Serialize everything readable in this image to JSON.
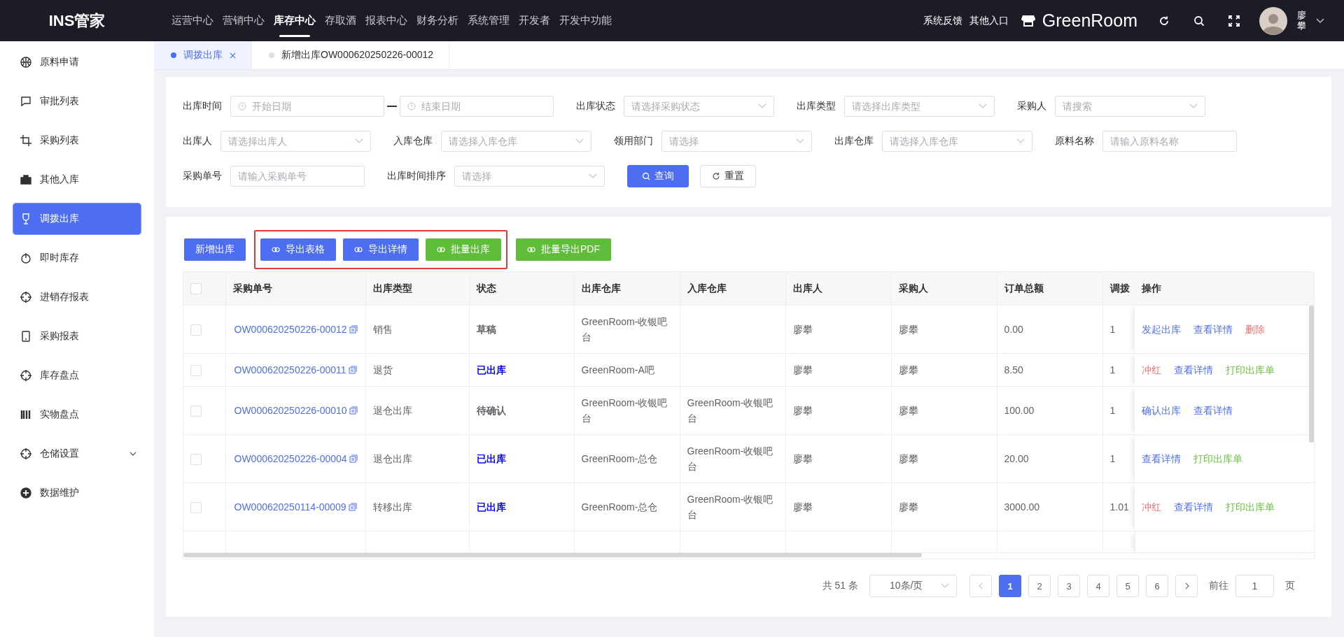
{
  "header": {
    "logo": "INS管家",
    "nav": [
      {
        "label": "运营中心",
        "selected": false
      },
      {
        "label": "营销中心",
        "selected": false
      },
      {
        "label": "库存中心",
        "selected": true
      },
      {
        "label": "存取酒",
        "selected": false
      },
      {
        "label": "报表中心",
        "selected": false
      },
      {
        "label": "财务分析",
        "selected": false
      },
      {
        "label": "系统管理",
        "selected": false
      },
      {
        "label": "开发者",
        "selected": false
      },
      {
        "label": "开发中功能",
        "selected": false
      }
    ],
    "links": [
      "系统反馈",
      "其他入口"
    ],
    "store": "GreenRoom",
    "user": "廖攀"
  },
  "sidebar": {
    "items": [
      {
        "label": "原料申请",
        "selected": false
      },
      {
        "label": "审批列表",
        "selected": false
      },
      {
        "label": "采购列表",
        "selected": false
      },
      {
        "label": "其他入库",
        "selected": false
      },
      {
        "label": "调拨出库",
        "selected": true
      },
      {
        "label": "即时库存",
        "selected": false
      },
      {
        "label": "进销存报表",
        "selected": false
      },
      {
        "label": "采购报表",
        "selected": false
      },
      {
        "label": "库存盘点",
        "selected": false
      },
      {
        "label": "实物盘点",
        "selected": false
      },
      {
        "label": "仓储设置",
        "selected": false,
        "expanded": false
      },
      {
        "label": "数据维护",
        "selected": false
      }
    ]
  },
  "tabs": [
    {
      "label": "调拨出库",
      "selected": true,
      "closable": true
    },
    {
      "label": "新增出库OW000620250226-00012",
      "selected": false,
      "closable": false
    }
  ],
  "filters": [
    [
      {
        "label": "出库时间",
        "kind": "date-range",
        "placeholder": "开始日期",
        "placeholder_end": "结束日期"
      },
      {
        "label": "出库状态",
        "kind": "select",
        "placeholder": "请选择采购状态"
      },
      {
        "label": "出库类型",
        "kind": "select",
        "placeholder": "请选择出库类型"
      },
      {
        "label": "采购人",
        "kind": "select",
        "placeholder": "请搜索"
      }
    ],
    [
      {
        "label": "出库人",
        "kind": "select",
        "placeholder": "请选择出库人"
      },
      {
        "label": "入库仓库",
        "kind": "select",
        "placeholder": "请选择入库仓库"
      },
      {
        "label": "领用部门",
        "kind": "select",
        "placeholder": "请选择"
      },
      {
        "label": "出库仓库",
        "kind": "select",
        "placeholder": "请选择入库仓库"
      },
      {
        "label": "原料名称",
        "kind": "input",
        "placeholder": "请输入原料名称"
      }
    ],
    [
      {
        "label": "采购单号",
        "kind": "input",
        "placeholder": "请输入采购单号"
      },
      {
        "label": "出库时间排序",
        "kind": "select",
        "placeholder": "请选择"
      }
    ]
  ],
  "filter_buttons": [
    {
      "label": "查询",
      "kind": "primary"
    },
    {
      "label": "重置",
      "kind": "default"
    }
  ],
  "action_groups": [
    {
      "framed": false,
      "buttons": [
        {
          "label": "新增出库",
          "kind": "primary",
          "icon": false
        }
      ]
    },
    {
      "framed": true,
      "buttons": [
        {
          "label": "导出表格",
          "kind": "primary",
          "icon": true
        },
        {
          "label": "导出详情",
          "kind": "primary",
          "icon": true
        },
        {
          "label": "批量出库",
          "kind": "success",
          "icon": true
        }
      ]
    },
    {
      "framed": false,
      "buttons": [
        {
          "label": "批量导出PDF",
          "kind": "success",
          "icon": true
        }
      ]
    }
  ],
  "table": {
    "select_all_checked": false,
    "columns": [
      "采购单号",
      "出库类型",
      "状态",
      "出库仓库",
      "入库仓库",
      "出库人",
      "采购人",
      "订单总额",
      "调拨",
      "操作"
    ],
    "rows": [
      {
        "checked": false,
        "order": "OW000620250226-00012",
        "type": "销售",
        "status": {
          "text": "草稿",
          "color": "#606266"
        },
        "out_wh": "GreenRoom-收银吧台",
        "in_wh": "",
        "out_person": "廖攀",
        "buyer": "廖攀",
        "total": "0.00",
        "transfer": "1",
        "ops": [
          {
            "label": "发起出库",
            "kind": "primary"
          },
          {
            "label": "查看详情",
            "kind": "primary"
          },
          {
            "label": "删除",
            "kind": "danger"
          }
        ]
      },
      {
        "checked": false,
        "order": "OW000620250226-00011",
        "type": "退货",
        "status": {
          "text": "已出库",
          "color": "#0000ff"
        },
        "out_wh": "GreenRoom-A吧",
        "in_wh": "",
        "out_person": "廖攀",
        "buyer": "廖攀",
        "total": "8.50",
        "transfer": "1",
        "ops": [
          {
            "label": "冲红",
            "kind": "danger"
          },
          {
            "label": "查看详情",
            "kind": "primary"
          },
          {
            "label": "打印出库单",
            "kind": "success"
          }
        ]
      },
      {
        "checked": false,
        "order": "OW000620250226-00010",
        "type": "退仓出库",
        "status": {
          "text": "待确认",
          "color": "#606266"
        },
        "out_wh": "GreenRoom-收银吧台",
        "in_wh": "GreenRoom-收银吧台",
        "out_person": "廖攀",
        "buyer": "廖攀",
        "total": "100.00",
        "transfer": "1",
        "ops": [
          {
            "label": "确认出库",
            "kind": "primary"
          },
          {
            "label": "查看详情",
            "kind": "primary"
          }
        ]
      },
      {
        "checked": false,
        "order": "OW000620250226-00004",
        "type": "退仓出库",
        "status": {
          "text": "已出库",
          "color": "#0000ff"
        },
        "out_wh": "GreenRoom-总仓",
        "in_wh": "GreenRoom-收银吧台",
        "out_person": "廖攀",
        "buyer": "廖攀",
        "total": "20.00",
        "transfer": "1",
        "ops": [
          {
            "label": "查看详情",
            "kind": "primary"
          },
          {
            "label": "打印出库单",
            "kind": "success"
          }
        ]
      },
      {
        "checked": false,
        "order": "OW000620250114-00009",
        "type": "转移出库",
        "status": {
          "text": "已出库",
          "color": "#0000ff"
        },
        "out_wh": "GreenRoom-总仓",
        "in_wh": "GreenRoom-收银吧台",
        "out_person": "廖攀",
        "buyer": "廖攀",
        "total": "3000.00",
        "transfer": "1.01",
        "ops": [
          {
            "label": "冲红",
            "kind": "danger"
          },
          {
            "label": "查看详情",
            "kind": "primary"
          },
          {
            "label": "打印出库单",
            "kind": "success"
          }
        ]
      }
    ]
  },
  "pagination": {
    "total": "共 51 条",
    "page_size": "10条/页",
    "pages": [
      {
        "label": "1",
        "selected": true
      },
      {
        "label": "2",
        "selected": false
      },
      {
        "label": "3",
        "selected": false
      },
      {
        "label": "4",
        "selected": false
      },
      {
        "label": "5",
        "selected": false
      },
      {
        "label": "6",
        "selected": false
      }
    ],
    "goto_label": "前往",
    "goto_value": "1",
    "goto_suffix": "页"
  }
}
